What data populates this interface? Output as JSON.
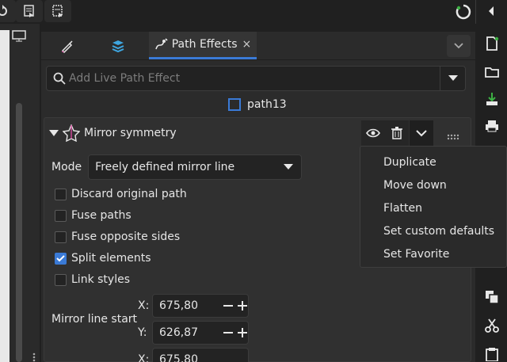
{
  "colors": {
    "accent": "#3a7ad6",
    "panel": "#2b2b2b",
    "background": "#202020"
  },
  "tabs": [
    {
      "name": "fill-stroke",
      "icon": "pen-brush-icon"
    },
    {
      "name": "layers",
      "icon": "layers-icon"
    },
    {
      "name": "path-effects",
      "icon": "path-effects-icon",
      "label": "Path Effects",
      "close": "×",
      "active": true
    }
  ],
  "search": {
    "placeholder": "Add Live Path Effect",
    "value": ""
  },
  "object": {
    "label": "path13"
  },
  "effect": {
    "title": "Mirror symmetry",
    "mode_label": "Mode",
    "mode_value": "Freely defined mirror line",
    "options": [
      {
        "label": "Discard original path",
        "checked": false
      },
      {
        "label": "Fuse paths",
        "checked": false
      },
      {
        "label": "Fuse opposite sides",
        "checked": false
      },
      {
        "label": "Split elements",
        "checked": true
      },
      {
        "label": "Link styles",
        "checked": false
      }
    ],
    "mirror_start_label": "Mirror line start",
    "start_x_label": "X:",
    "start_x": "675,80",
    "start_y_label": "Y:",
    "start_y": "626,87",
    "end_x_label": "X:",
    "end_x": "675,80",
    "minus": "−",
    "plus": "+"
  },
  "menu": {
    "items": [
      "Duplicate",
      "Move down",
      "Flatten",
      "Set custom defaults",
      "Set Favorite"
    ]
  }
}
